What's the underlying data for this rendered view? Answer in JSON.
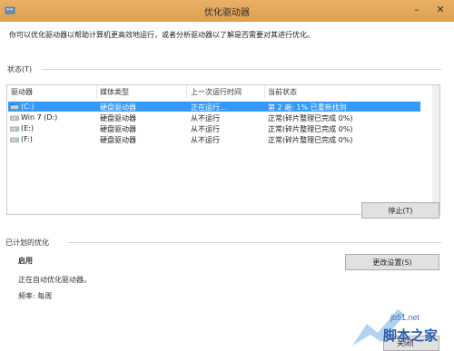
{
  "window": {
    "title": "优化驱动器"
  },
  "description": "你可以优化驱动器以帮助计算机更高效地运行，或者分析驱动器以了解是否需要对其进行优化。",
  "status": {
    "label": "状态(T)",
    "columns": [
      "驱动器",
      "媒体类型",
      "上一次运行时间",
      "当前状态"
    ],
    "rows": [
      {
        "drive": "(C:)",
        "media": "硬盘驱动器",
        "last_run": "正在运行...",
        "status": "第 2 遍: 1% 已重新找到",
        "selected": true
      },
      {
        "drive": "Win 7 (D:)",
        "media": "硬盘驱动器",
        "last_run": "从不运行",
        "status": "正常(碎片整理已完成 0%)",
        "selected": false
      },
      {
        "drive": "(E:)",
        "media": "硬盘驱动器",
        "last_run": "从不运行",
        "status": "正常(碎片整理已完成 0%)",
        "selected": false
      },
      {
        "drive": "(F:)",
        "media": "硬盘驱动器",
        "last_run": "从不运行",
        "status": "正常(碎片整理已完成 0%)",
        "selected": false
      }
    ],
    "stop_button": "停止(T)"
  },
  "scheduled": {
    "label": "已计划的优化",
    "state": "启用",
    "detail": "正在自动优化驱动器。",
    "frequency": "频率: 每周",
    "change_button": "更改设置(S)"
  },
  "close_button_partial": "关闭(",
  "watermark": {
    "url": "jb51.net",
    "brand": "脚本之家"
  },
  "colors": {
    "titlebar": "#e0a558",
    "selection": "#3399ff"
  }
}
